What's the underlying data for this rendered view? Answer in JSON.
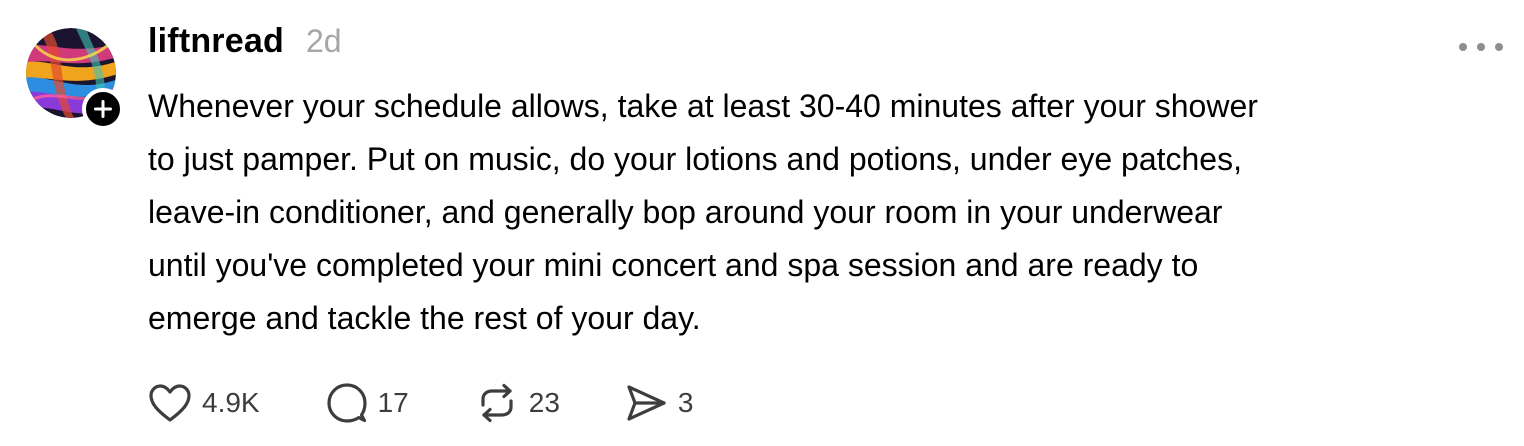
{
  "post": {
    "username": "liftnread",
    "timestamp": "2d",
    "text_lines": [
      "Whenever your schedule allows, take at least 30-40 minutes after your shower",
      "to just pamper. Put on music, do your lotions and potions, under eye patches,",
      "leave-in conditioner, and generally bop around your room in your underwear",
      "until you've completed your mini concert and spa session and are ready to",
      "emerge and tackle the rest of your day."
    ]
  },
  "actions": {
    "likes": "4.9K",
    "replies": "17",
    "reposts": "23",
    "shares": "3"
  },
  "icons": {
    "like": "heart-icon",
    "reply": "speech-bubble-icon",
    "repost": "repost-arrows-icon",
    "share": "paper-plane-icon",
    "more": "ellipsis-icon",
    "follow": "plus-icon"
  },
  "colors": {
    "text": "#000000",
    "muted": "#a6a6a6",
    "action": "#3d3d3d",
    "background": "#ffffff"
  }
}
